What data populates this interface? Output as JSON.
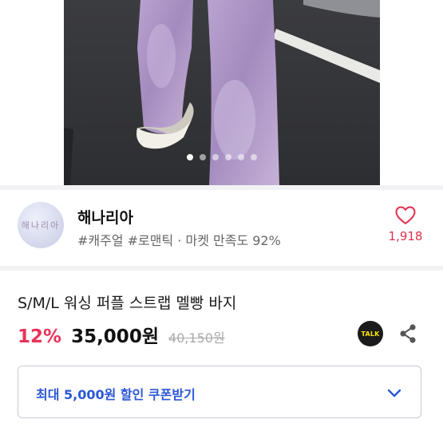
{
  "gallery": {
    "slide_count": 6,
    "active_index": 0
  },
  "shop": {
    "avatar_text": "해나리아",
    "name": "해나리아",
    "tags": "#캐주얼 #로맨틱 · 마켓 만족도 92%",
    "like_count": "1,918"
  },
  "product": {
    "title": "S/M/L 워싱 퍼플 스트랩 멜빵 바지",
    "discount": "12%",
    "price": "35,000원",
    "original_price": "40,150원",
    "talk_label": "TALK"
  },
  "coupon": {
    "label": "최대 5,000원 할인 쿠폰받기"
  },
  "icons": {
    "like": "heart-outline-icon",
    "chat": "kakao-talk-icon",
    "share": "share-icon",
    "expand": "chevron-down-icon"
  },
  "colors": {
    "accent_pink": "#e8335a",
    "coupon_blue": "#2b56d6",
    "divider": "#f2f2f4"
  }
}
